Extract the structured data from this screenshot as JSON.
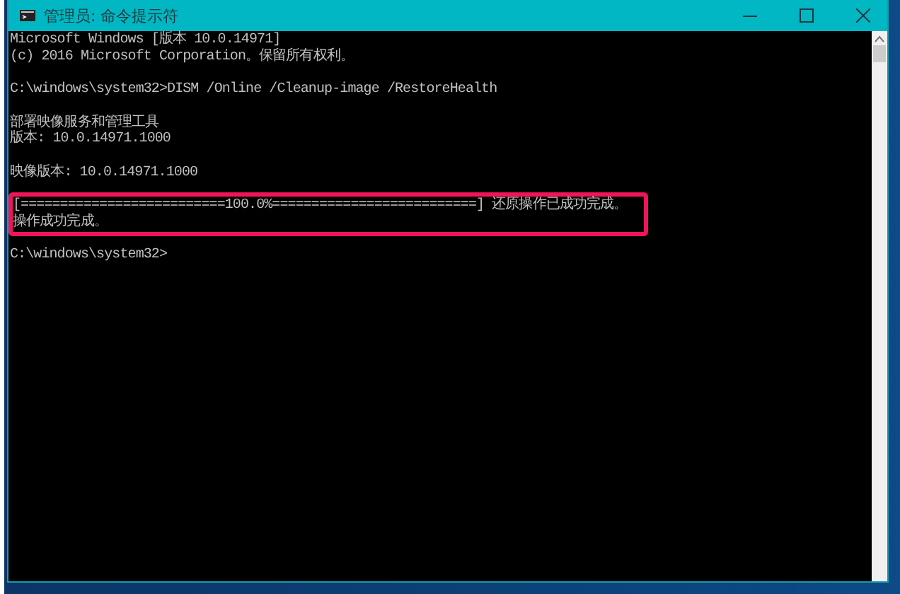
{
  "window": {
    "title": "管理员: 命令提示符"
  },
  "console": {
    "blocks": [
      {
        "lines": [
          "Microsoft Windows [版本 10.0.14971]",
          "(c) 2016 Microsoft Corporation。保留所有权利。"
        ],
        "highlighted": false
      },
      {
        "lines": [
          "C:\\windows\\system32>DISM /Online /Cleanup-image /RestoreHealth"
        ],
        "highlighted": false
      },
      {
        "lines": [
          "部署映像服务和管理工具",
          "版本: 10.0.14971.1000"
        ],
        "highlighted": false
      },
      {
        "lines": [
          "映像版本: 10.0.14971.1000"
        ],
        "highlighted": false
      },
      {
        "lines": [
          "[==========================100.0%==========================] 还原操作已成功完成。",
          "操作成功完成。"
        ],
        "highlighted": true
      },
      {
        "lines": [
          "C:\\windows\\system32>"
        ],
        "highlighted": false
      }
    ]
  }
}
